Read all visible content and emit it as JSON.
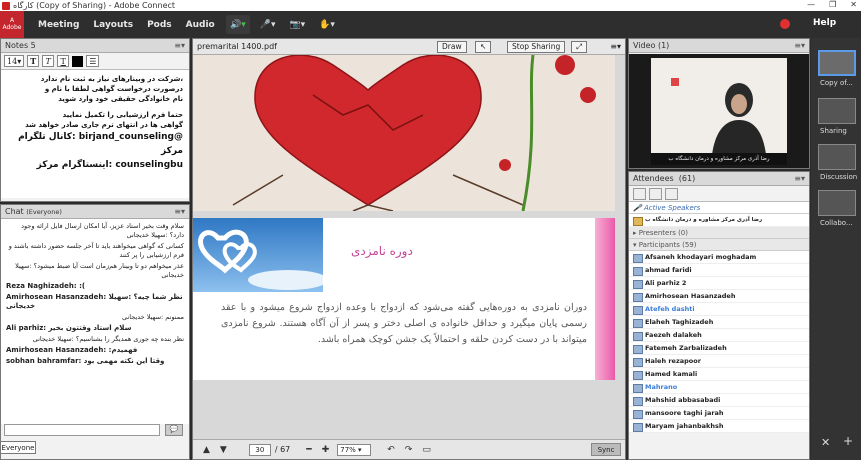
{
  "window": {
    "title": "کارگاه (Copy of Sharing) - Adobe Connect",
    "controls": [
      "—",
      "❐",
      "✕"
    ]
  },
  "menubar": {
    "logo": "Adobe",
    "items": [
      "Meeting",
      "Layouts",
      "Pods",
      "Audio"
    ],
    "help": "Help"
  },
  "notes": {
    "title": "Notes 5",
    "font_size": "14",
    "lines": [
      "،شرکت در وبینارهای نیاز به ثبت نام ندارد",
      "درصورت درخواست گواهی لطفا با نام و",
      "نام خانوادگی حقیقی خود وارد شوید",
      "حتما فرم ارزشیابی را تکمیل نمایید",
      "گواهی ها در انتهای ترم جاری صادر خواهد شد",
      "@birjand_counseling :کانال تلگرام مرکز",
      "counselingbu :اینستاگرام مرکز"
    ]
  },
  "chat": {
    "title": "Chat",
    "scope": "(Everyone)",
    "messages": [
      {
        "text": "سلام وقت بخیر استاد عزیز، آیا امکان ارسال فایل ارائه وجود دارد؟ :سهیلا خدیجانی",
        "rtl": true
      },
      {
        "text": "کسانی که گواهی میخواهند باید تا آخر جلسه حضور داشته باشند و فرم ارزشیابی را پر کنند",
        "rtl": true
      },
      {
        "text": "عذر میخواهم دو تا وبینار هم‌زمان است آیا ضبط میشود؟ :سهیلا خدیجانی",
        "rtl": true
      },
      {
        "text": "Reza Naghizadeh: :(",
        "rtl": false
      },
      {
        "text": "Amirhosean Hasanzadeh: نظر شما چیه؟ :سهیلا خدیجانی",
        "rtl": false
      },
      {
        "text": "ممنونم :سهیلا خدیجانی",
        "rtl": true
      },
      {
        "text": "Ali parhiz: سلام استاد وقتتون بخیر",
        "rtl": false
      },
      {
        "text": "نظر بنده چه جوری همدیگر را بشناسیم؟ :سهیلا خدیجانی",
        "rtl": true
      },
      {
        "text": "Amirhosean Hasanzadeh: :فهمیدم",
        "rtl": false
      },
      {
        "text": "sobhan bahramfar: وقتا این نکته مهمی بود",
        "rtl": false
      }
    ],
    "send": "💬",
    "tab": "Everyone"
  },
  "share": {
    "file": "premarital 1400.pdf",
    "draw": "Draw",
    "stop": "Stop Sharing",
    "slide_title": "دوره نامزدی",
    "slide_text": "دوران نامزدی به دوره‌هایی گفته می‌شود که ازدواج با وعده ازدواج شروع میشود و با عقد رسمی پایان میگیرد و حداقل خانواده ی اصلی دختر و پسر از آن آگاه هستند. شروع نامزدی میتواند با در دست کردن حلقه و احتمالاً یک جشن کوچک همراه باشد.",
    "page": "30",
    "total": "/ 67",
    "zoom": "77%",
    "sync": "Sync"
  },
  "video": {
    "title": "Video",
    "count": "(1)",
    "caption": "رضا آذری مرکز مشاوره و درمان دانشگاه ب"
  },
  "attendees": {
    "title": "Attendees",
    "count": "(61)",
    "active_speakers": "Active Speakers",
    "active_speaker_name": "رضا آذری مرکز مشاوره و درمان دانشگاه ب",
    "presenters": "Presenters (0)",
    "participants_label": "Participants (59)",
    "participants": [
      {
        "name": "Afsaneh khodayari moghadam",
        "blue": false
      },
      {
        "name": "ahmad faridi",
        "blue": false
      },
      {
        "name": "Ali parhiz 2",
        "blue": false
      },
      {
        "name": "Amirhosean Hasanzadeh",
        "blue": false
      },
      {
        "name": "Atefeh dashti",
        "blue": true
      },
      {
        "name": "Elaheh Taghizadeh",
        "blue": false
      },
      {
        "name": "Faezeh dalakeh",
        "blue": false
      },
      {
        "name": "Fatemeh Zarbalizadeh",
        "blue": false
      },
      {
        "name": "Haleh rezapoor",
        "blue": false
      },
      {
        "name": "Hamed kamali",
        "blue": false
      },
      {
        "name": "Mahrano",
        "blue": true
      },
      {
        "name": "Mahshid abbasabadi",
        "blue": false
      },
      {
        "name": "mansoore taghi jarah",
        "blue": false
      },
      {
        "name": "Maryam jahanbakhsh",
        "blue": false
      }
    ]
  },
  "layouts": {
    "items": [
      "Copy of...",
      "Sharing",
      "Discussion",
      "Collabo..."
    ]
  },
  "colors": {
    "menubar": "#2e2e2e",
    "logo": "#c3262d",
    "accent_blue": "#5a9ae6",
    "slide_title": "#c44595"
  }
}
